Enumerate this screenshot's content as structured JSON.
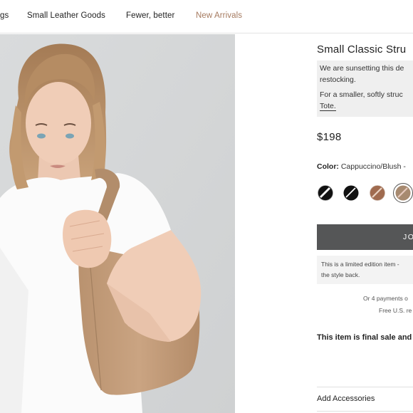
{
  "nav": {
    "items": [
      {
        "label": "gs",
        "accent": false
      },
      {
        "label": "Small Leather Goods",
        "accent": false
      },
      {
        "label": "Fewer, better",
        "accent": false
      },
      {
        "label": "New Arrivals",
        "accent": true
      }
    ]
  },
  "product": {
    "title": "Small Classic Stru",
    "notice_line1": "We are sunsetting this de",
    "notice_line2": "restocking.",
    "notice_line3": "For a smaller, softly struc",
    "notice_link": "Tote.",
    "price": "$198",
    "color_label": "Color:",
    "color_value": "Cappuccino/Blush -",
    "swatches": [
      {
        "name": "black-white",
        "colors": [
          "#111111",
          "#f4f4f4"
        ]
      },
      {
        "name": "black",
        "colors": [
          "#111111",
          "#111111"
        ]
      },
      {
        "name": "brown",
        "colors": [
          "#a06b4f",
          "#c89a80"
        ]
      },
      {
        "name": "cappuccino-blush",
        "colors": [
          "#a78a70",
          "#e6c9bd"
        ],
        "selected": true
      }
    ],
    "cta_label": "JO",
    "limited_line1": "This is a limited edition item -",
    "limited_line2": "the style back.",
    "payments_line1": "Or 4 payments o",
    "payments_line2": "Free U.S. re",
    "final_sale": "This item is final sale and",
    "accessories_label": "Add Accessories"
  },
  "colors": {
    "accent": "#a57a5f",
    "cta_background": "#555657",
    "notice_background": "#efefef",
    "photo_background": "#d6d8d9"
  }
}
